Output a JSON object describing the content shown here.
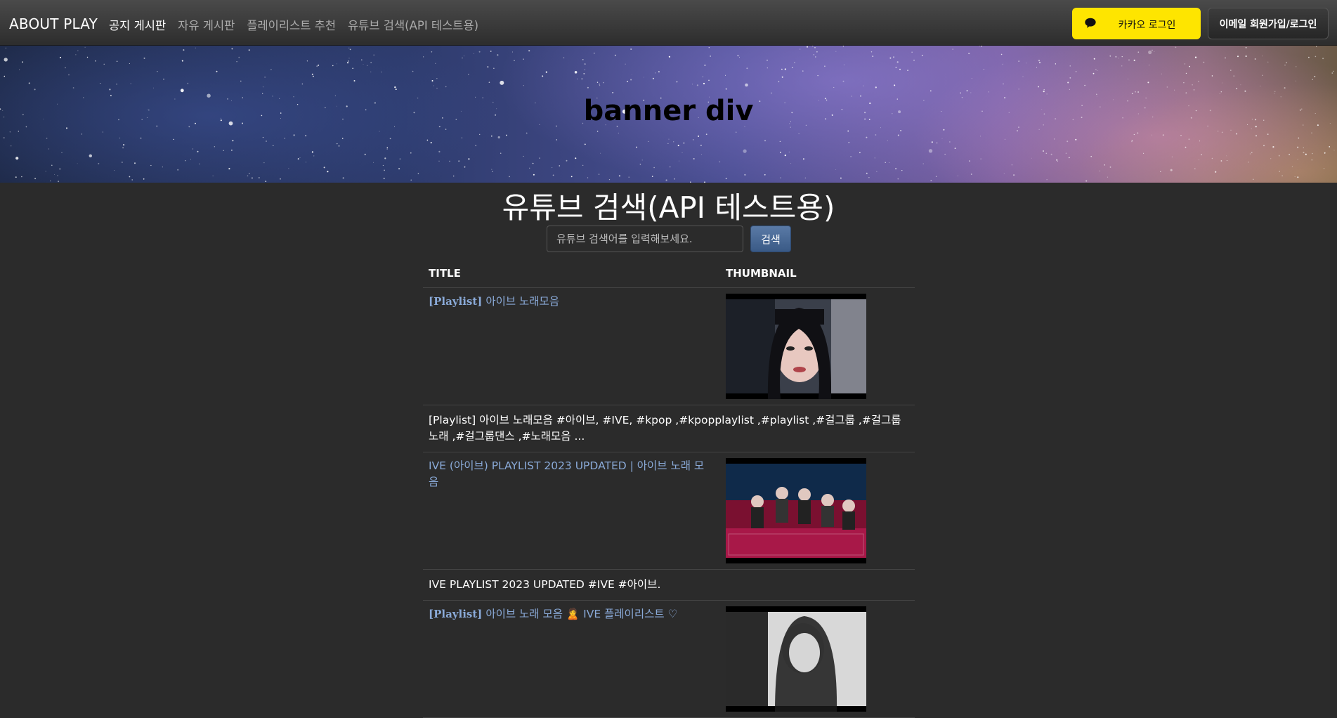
{
  "navbar": {
    "brand": "ABOUT PLAY",
    "links": [
      {
        "label": "공지 게시판",
        "active": true
      },
      {
        "label": "자유 게시판",
        "active": false
      },
      {
        "label": "플레이리스트 추천",
        "active": false
      },
      {
        "label": "유튜브 검색(API 테스트용)",
        "active": false
      }
    ],
    "kakao_login": "카카오 로그인",
    "email_login": "이메일 회원가입/로그인",
    "kakao_color": "#fee500"
  },
  "banner": {
    "title": "banner div"
  },
  "main": {
    "title": "유튜브 검색(API 테스트용)",
    "search_placeholder": "유튜브 검색어를 입력해보세요.",
    "search_button": "검색",
    "columns": [
      "TITLE",
      "THUMBNAIL"
    ],
    "results": [
      {
        "title_bracket": "[Playlist]",
        "title_rest": " 아이브 노래모음",
        "description": "[Playlist] 아이브 노래모음 #아이브, #IVE, #kpop ,#kpopplaylist ,#playlist ,#걸그룹 ,#걸그룹노래 ,#걸그룹댄스 ,#노래모음 ...",
        "thumbnail_icon": "portrait-thumbnail"
      },
      {
        "title_bracket": "",
        "title_rest": "IVE (아이브) PLAYLIST 2023 UPDATED | 아이브 노래 모음",
        "description": "IVE PLAYLIST 2023 UPDATED #IVE #아이브.",
        "thumbnail_icon": "group-thumbnail"
      },
      {
        "title_bracket": "[Playlist]",
        "title_rest": " 아이브 노래 모음 🙎 IVE 플레이리스트 ♡",
        "description": "",
        "thumbnail_icon": "bw-thumbnail"
      }
    ]
  }
}
